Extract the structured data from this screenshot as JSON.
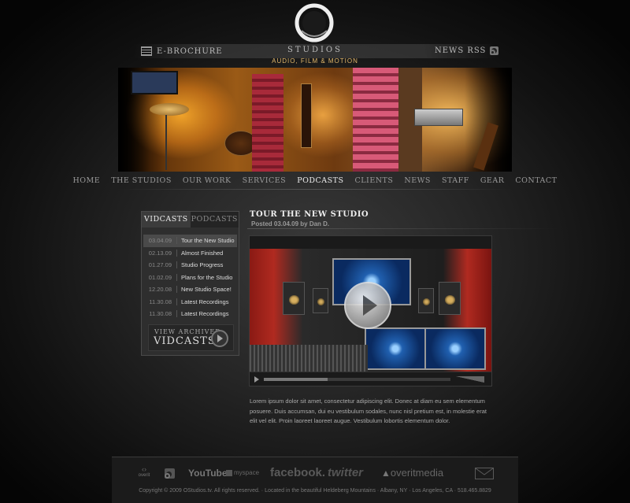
{
  "brand": {
    "name": "STUDIOS",
    "tagline": "AUDIO, FILM & MOTION",
    "logo_letter": "O"
  },
  "header": {
    "ebrochure_label": "E-BROCHURE",
    "ebrochure_icon": "brochure-icon",
    "rss_label": "NEWS RSS",
    "rss_icon": "rss-icon"
  },
  "nav": {
    "items": [
      "HOME",
      "THE STUDIOS",
      "OUR WORK",
      "SERVICES",
      "PODCASTS",
      "CLIENTS",
      "NEWS",
      "STAFF",
      "GEAR",
      "CONTACT"
    ],
    "active": "PODCASTS"
  },
  "sidebar": {
    "tabs": [
      "VIDCASTS",
      "PODCASTS"
    ],
    "active_tab": "VIDCASTS",
    "entries": [
      {
        "date": "03.04.09",
        "title": "Tour the New Studio"
      },
      {
        "date": "02.13.09",
        "title": "Almost Finished"
      },
      {
        "date": "01.27.09",
        "title": "Studio Progress"
      },
      {
        "date": "01.02.09",
        "title": "Plans for the Studio"
      },
      {
        "date": "12.20.08",
        "title": "New Studio Space!"
      },
      {
        "date": "11.30.08",
        "title": "Latest Recordings"
      },
      {
        "date": "11.30.08",
        "title": "Latest Recordings"
      }
    ],
    "archive_small": "VIEW ARCHIVED",
    "archive_big": "VIDCASTS"
  },
  "post": {
    "title": "TOUR THE NEW STUDIO",
    "meta": "Posted 03.04.09 by Dan D.",
    "body": "Lorem ipsum dolor sit amet, consectetur adipiscing elit. Donec at diam eu sem elementum posuere. Duis accumsan, dui eu vestibulum sodales, nunc nisl pretium est, in molestie erat elit vel elit. Proin laoreet laoreet augue. Vestibulum lobortis elementum dolor.",
    "video_progress": 0.34
  },
  "footer": {
    "social": [
      {
        "label": "overit",
        "icon": "overit-icon"
      },
      {
        "label": "",
        "icon": "rss-icon"
      },
      {
        "label": "YouTube",
        "icon": "youtube-icon"
      },
      {
        "label": "myspace",
        "icon": "myspace-icon"
      },
      {
        "label": "facebook.",
        "icon": "facebook-icon"
      },
      {
        "label": "twitter",
        "icon": "twitter-icon"
      },
      {
        "label": "overitmedia",
        "icon": "overitmedia-icon"
      },
      {
        "label": "",
        "icon": "email-icon"
      }
    ],
    "copyright": "Copyright © 2009 OStudios.tv. All rights reserved. · Located in the beautiful Heldeberg Mountains · Albany, NY · Los Angeles, CA · 518.465.8829"
  }
}
